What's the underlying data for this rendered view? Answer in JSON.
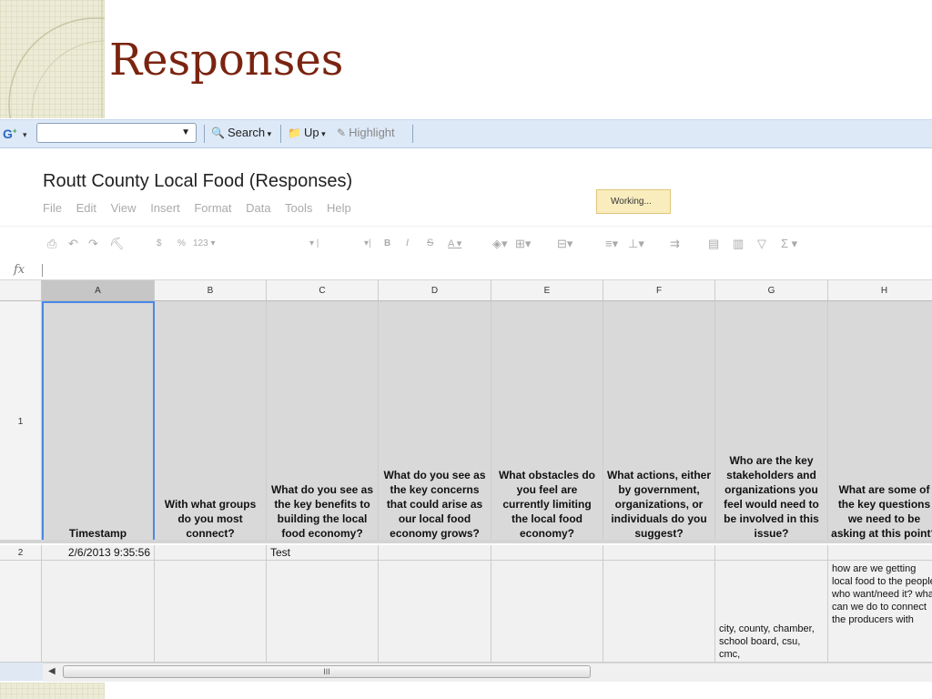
{
  "slide": {
    "title": "Responses"
  },
  "toolbar": {
    "g_label": "G",
    "search_label": "Search",
    "up_label": "Up",
    "highlight_label": "Highlight",
    "combo_value": ""
  },
  "document": {
    "title": "Routt County Local Food (Responses)",
    "menu": [
      "File",
      "Edit",
      "View",
      "Insert",
      "Format",
      "Data",
      "Tools",
      "Help"
    ],
    "status": "Working..."
  },
  "formatbar": {
    "currency": "$",
    "percent": "%",
    "number_format": "123",
    "bold": "B",
    "italic": "I",
    "strike": "S",
    "text_color": "A",
    "sum": "Σ"
  },
  "formula": {
    "fx_label": "fx",
    "value": ""
  },
  "sheet": {
    "columns": [
      "A",
      "B",
      "C",
      "D",
      "E",
      "F",
      "G",
      "H"
    ],
    "rows": [
      "1",
      "2",
      ""
    ],
    "header_row": [
      "Timestamp",
      "With what groups do you most connect?",
      "What do you see as the key benefits to building the local food economy?",
      "What do you see as the key concerns that could arise as our local food economy grows?",
      "What obstacles do you feel are currently limiting the local food economy?",
      "What actions, either by government, organizations, or individuals do you suggest?",
      "Who are the key stakeholders and organizations you feel would need to be involved in this issue?",
      "What are some of the key questions we need to be asking at this point?"
    ],
    "row2": [
      "2/6/2013 9:35:56",
      "",
      "Test",
      "",
      "",
      "",
      "",
      ""
    ],
    "row3": [
      "",
      "",
      "",
      "",
      "",
      "",
      "city, county, chamber, school board, csu, cmc,",
      "how are we getting local food to the people who want/need it? what can we do to connect the producers with"
    ]
  },
  "scrollbar": {
    "thumb_label": "III"
  },
  "colors": {
    "title": "#7a2410",
    "toolbar_bg": "#dde9f7",
    "selection": "#4a88e8",
    "working_bg": "#f9edbe"
  },
  "icons": [
    "google-toolbar-icon",
    "search-icon",
    "folder-up-icon",
    "highlighter-icon",
    "print-icon",
    "undo-icon",
    "redo-icon",
    "paint-format-icon",
    "fill-color-icon",
    "borders-icon",
    "merge-icon",
    "align-icon",
    "valign-icon",
    "wrap-icon",
    "comment-icon",
    "chart-icon",
    "filter-icon",
    "sum-icon"
  ]
}
